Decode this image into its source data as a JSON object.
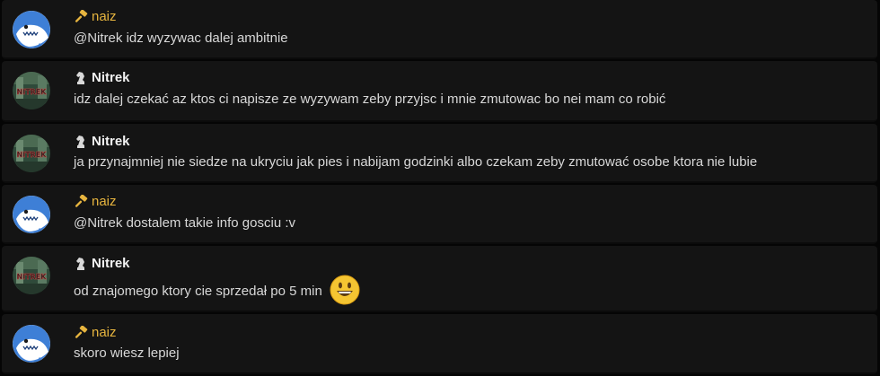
{
  "messages": [
    {
      "author": "naiz",
      "role_icon": "gavel-icon",
      "text": "@Nitrek idz wyzywac dalej ambitnie",
      "emoji": ""
    },
    {
      "author": "Nitrek",
      "role_icon": "knight-icon",
      "text": "idz dalej czekać az ktos ci napisze ze wyzywam zeby przyjsc i mnie zmutowac bo nei mam co robić",
      "emoji": ""
    },
    {
      "author": "Nitrek",
      "role_icon": "knight-icon",
      "text": "ja przynajmniej nie siedze na ukryciu jak pies i nabijam godzinki albo czekam zeby zmutować osobe ktora nie lubie",
      "emoji": ""
    },
    {
      "author": "naiz",
      "role_icon": "gavel-icon",
      "text": "@Nitrek dostalem takie info gosciu :v",
      "emoji": ""
    },
    {
      "author": "Nitrek",
      "role_icon": "knight-icon",
      "text": "od znajomego ktory cie sprzedał po 5 min",
      "emoji": "smiley-emoji"
    },
    {
      "author": "naiz",
      "role_icon": "gavel-icon",
      "text": "skoro wiesz lepiej",
      "emoji": ""
    }
  ],
  "avatars": {
    "naiz": "shark-avatar",
    "Nitrek": "nitrek-avatar",
    "nitrek_avatar_text": "NITREK"
  },
  "colors": {
    "naiz_name": "#e7b53f",
    "nitrek_name": "#f2f2f2",
    "message_text": "#d8d8d8",
    "message_bg": "#141414"
  }
}
